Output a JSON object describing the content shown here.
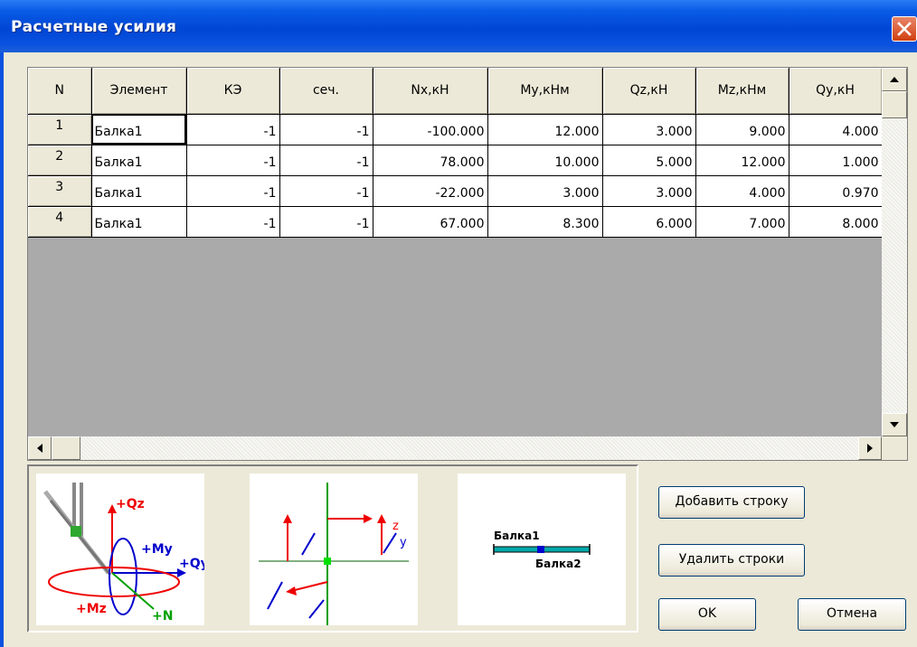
{
  "window": {
    "title": "Расчетные усилия"
  },
  "table": {
    "columns": [
      "N",
      "Элемент",
      "КЭ",
      "сеч.",
      "Nx,кН",
      "My,кНм",
      "Qz,кН",
      "Mz,кНм",
      "Qy,кН"
    ],
    "rows": [
      [
        "1",
        "Балка1",
        "-1",
        "-1",
        "-100.000",
        "12.000",
        "3.000",
        "9.000",
        "4.000"
      ],
      [
        "2",
        "Балка1",
        "-1",
        "-1",
        "78.000",
        "10.000",
        "5.000",
        "12.000",
        "1.000"
      ],
      [
        "3",
        "Балка1",
        "-1",
        "-1",
        "-22.000",
        "3.000",
        "3.000",
        "4.000",
        "0.970"
      ],
      [
        "4",
        "Балка1",
        "-1",
        "-1",
        "67.000",
        "8.300",
        "6.000",
        "7.000",
        "8.000"
      ]
    ]
  },
  "pictures": {
    "forces_labels": {
      "qz": "+Qz",
      "my": "+My",
      "qy": "+Qy",
      "mz": "+Mz",
      "n": "+N"
    },
    "axes_labels": {
      "z": "z",
      "y": "y"
    },
    "beams_labels": {
      "beam1": "Балка1",
      "beam2": "Балка2"
    }
  },
  "buttons": {
    "add_row": "Добавить строку",
    "delete_rows": "Удалить строки",
    "ok": "OK",
    "cancel": "Отмена"
  },
  "colors": {
    "title_bar": "#0046d5",
    "grid_background": "#abaaab",
    "dialog": "#ece9d8"
  }
}
